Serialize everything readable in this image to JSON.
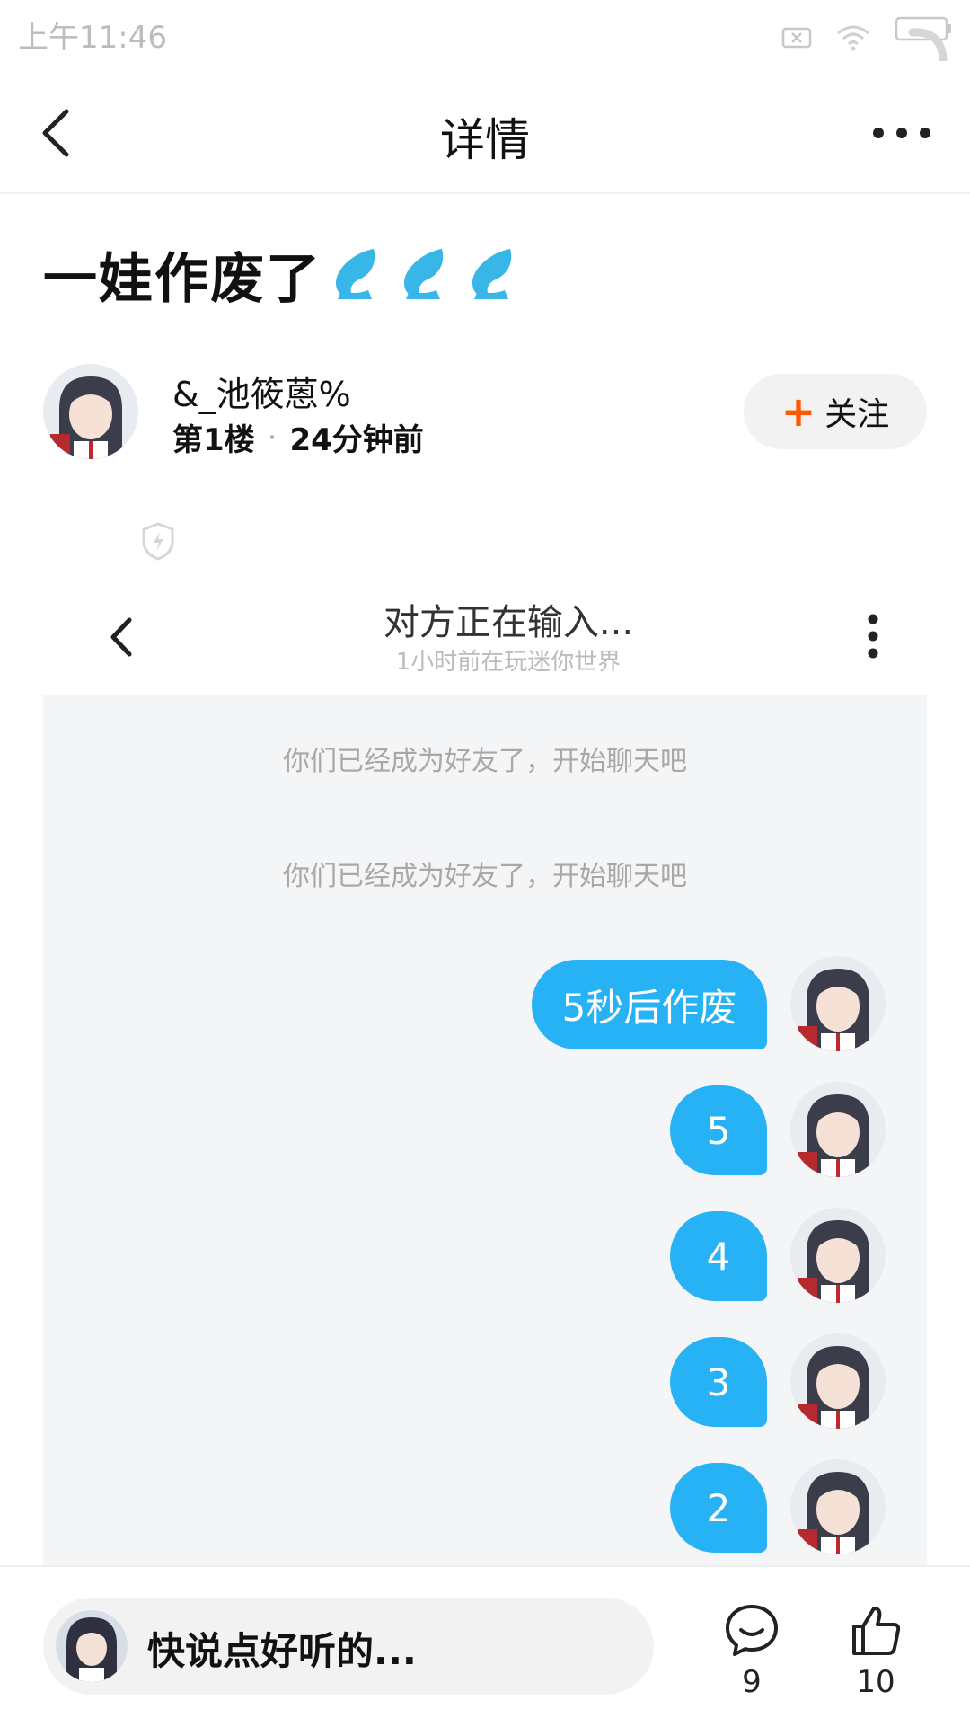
{
  "status_bar": {
    "time": "上午11:46"
  },
  "header": {
    "title": "详情"
  },
  "post": {
    "title": "一娃作废了",
    "author": {
      "name": "&_池筱蒽%",
      "floor": "第1楼",
      "time_ago": "24分钟前"
    },
    "follow_label": "关注"
  },
  "screenshot": {
    "title": "对方正在输入...",
    "subtitle": "1小时前在玩迷你世界",
    "system_messages": [
      "你们已经成为好友了，开始聊天吧",
      "你们已经成为好友了，开始聊天吧"
    ],
    "messages": [
      "5秒后作废",
      "5",
      "4",
      "3",
      "2"
    ]
  },
  "bottom_bar": {
    "comment_placeholder": "快说点好听的...",
    "comment_count": "9",
    "like_count": "10"
  },
  "colors": {
    "accent_blue": "#26b2f5",
    "follow_plus": "#ff5a00",
    "chat_bg": "#f4f5f7"
  }
}
